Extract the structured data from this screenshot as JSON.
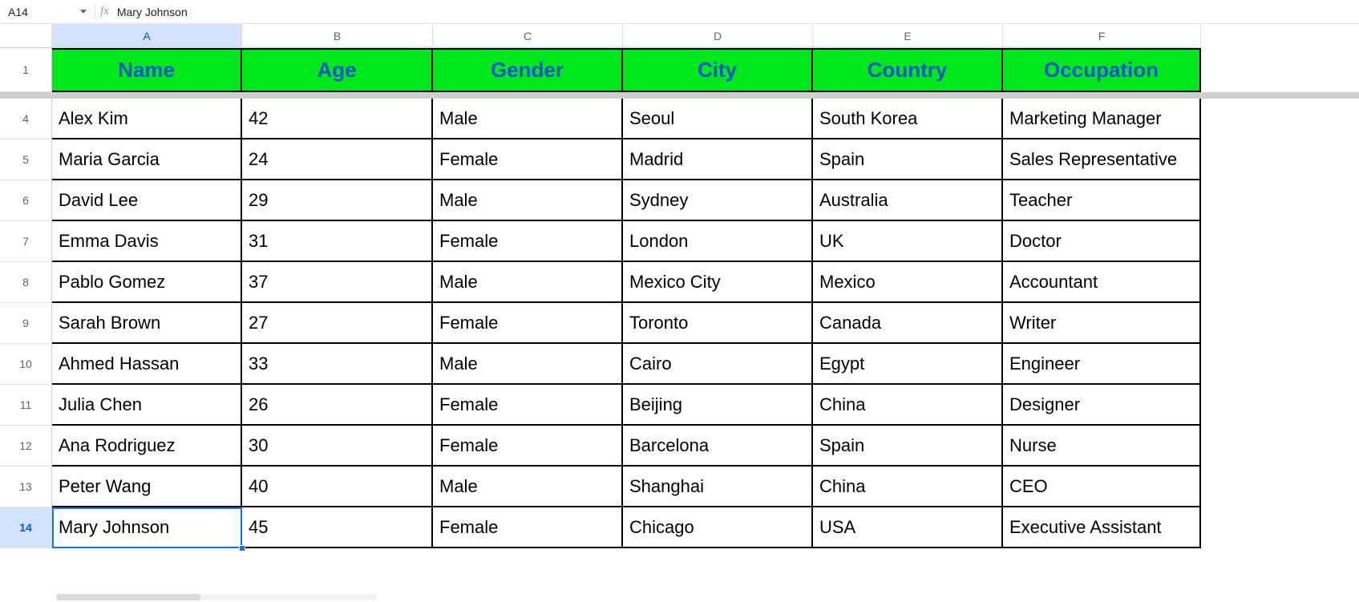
{
  "formula_bar": {
    "cell_ref": "A14",
    "value": "Mary Johnson"
  },
  "selection": {
    "col": "A",
    "row": 14
  },
  "columns": [
    "A",
    "B",
    "C",
    "D",
    "E",
    "F"
  ],
  "visible_row_numbers": [
    1,
    4,
    5,
    6,
    7,
    8,
    9,
    10,
    11,
    12,
    13,
    14
  ],
  "header_row": [
    "Name",
    "Age",
    "Gender",
    "City",
    "Country",
    "Occupation"
  ],
  "rows": [
    {
      "n": 4,
      "c": [
        "Alex Kim",
        "42",
        "Male",
        "Seoul",
        "South Korea",
        "Marketing Manager"
      ]
    },
    {
      "n": 5,
      "c": [
        "Maria Garcia",
        "24",
        "Female",
        "Madrid",
        "Spain",
        "Sales Representative"
      ]
    },
    {
      "n": 6,
      "c": [
        "David Lee",
        "29",
        "Male",
        "Sydney",
        "Australia",
        "Teacher"
      ]
    },
    {
      "n": 7,
      "c": [
        "Emma Davis",
        "31",
        "Female",
        "London",
        "UK",
        "Doctor"
      ]
    },
    {
      "n": 8,
      "c": [
        "Pablo Gomez",
        "37",
        "Male",
        "Mexico City",
        "Mexico",
        "Accountant"
      ]
    },
    {
      "n": 9,
      "c": [
        "Sarah Brown",
        "27",
        "Female",
        "Toronto",
        "Canada",
        "Writer"
      ]
    },
    {
      "n": 10,
      "c": [
        "Ahmed Hassan",
        "33",
        "Male",
        "Cairo",
        "Egypt",
        "Engineer"
      ]
    },
    {
      "n": 11,
      "c": [
        "Julia Chen",
        "26",
        "Female",
        "Beijing",
        "China",
        "Designer"
      ]
    },
    {
      "n": 12,
      "c": [
        "Ana Rodriguez",
        "30",
        "Female",
        "Barcelona",
        "Spain",
        "Nurse"
      ]
    },
    {
      "n": 13,
      "c": [
        "Peter Wang",
        "40",
        "Male",
        "Shanghai",
        "China",
        "CEO"
      ]
    },
    {
      "n": 14,
      "c": [
        "Mary Johnson",
        "45",
        "Female",
        "Chicago",
        "USA",
        "Executive Assistant"
      ]
    }
  ],
  "chart_data": {
    "type": "table",
    "columns": [
      "Name",
      "Age",
      "Gender",
      "City",
      "Country",
      "Occupation"
    ],
    "rows": [
      [
        "Alex Kim",
        42,
        "Male",
        "Seoul",
        "South Korea",
        "Marketing Manager"
      ],
      [
        "Maria Garcia",
        24,
        "Female",
        "Madrid",
        "Spain",
        "Sales Representative"
      ],
      [
        "David Lee",
        29,
        "Male",
        "Sydney",
        "Australia",
        "Teacher"
      ],
      [
        "Emma Davis",
        31,
        "Female",
        "London",
        "UK",
        "Doctor"
      ],
      [
        "Pablo Gomez",
        37,
        "Male",
        "Mexico City",
        "Mexico",
        "Accountant"
      ],
      [
        "Sarah Brown",
        27,
        "Female",
        "Toronto",
        "Canada",
        "Writer"
      ],
      [
        "Ahmed Hassan",
        33,
        "Male",
        "Cairo",
        "Egypt",
        "Engineer"
      ],
      [
        "Julia Chen",
        26,
        "Female",
        "Beijing",
        "China",
        "Designer"
      ],
      [
        "Ana Rodriguez",
        30,
        "Female",
        "Barcelona",
        "Spain",
        "Nurse"
      ],
      [
        "Peter Wang",
        40,
        "Male",
        "Shanghai",
        "China",
        "CEO"
      ],
      [
        "Mary Johnson",
        45,
        "Female",
        "Chicago",
        "USA",
        "Executive Assistant"
      ]
    ]
  }
}
